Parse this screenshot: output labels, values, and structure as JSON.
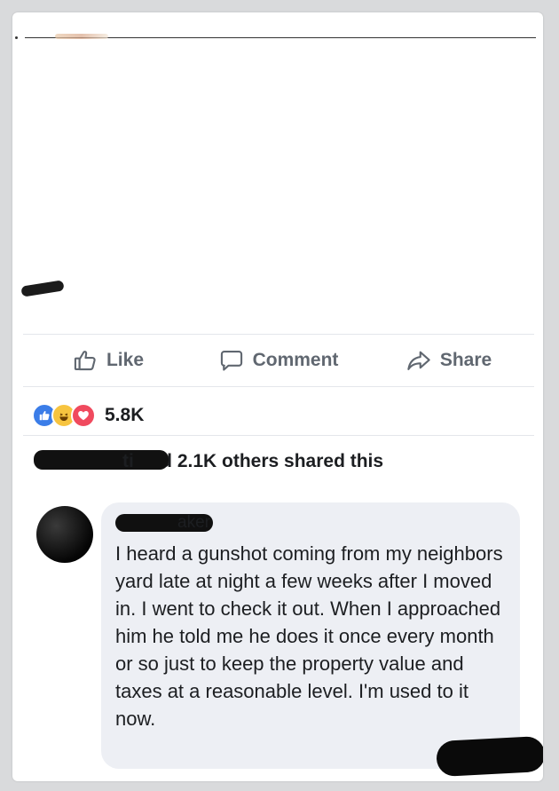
{
  "actions": {
    "like_label": "Like",
    "comment_label": "Comment",
    "share_label": "Share"
  },
  "reactions": {
    "count": "5.8K",
    "types": [
      "like",
      "haha",
      "love"
    ],
    "colors": {
      "like": "#3b7de8",
      "haha": "#f7c43f",
      "love": "#f04a5e"
    }
  },
  "shares": {
    "name_visible_tail": "ti",
    "text": " and 2.1K others shared this"
  },
  "comment": {
    "author_visible": "aker",
    "text": "I heard a gunshot coming from my neighbors yard late at night a few weeks after I moved in. I went to check it out. When I approached him he told me he does it once every month or so just to keep the property value and taxes at a reasonable level. I'm used to it now."
  }
}
